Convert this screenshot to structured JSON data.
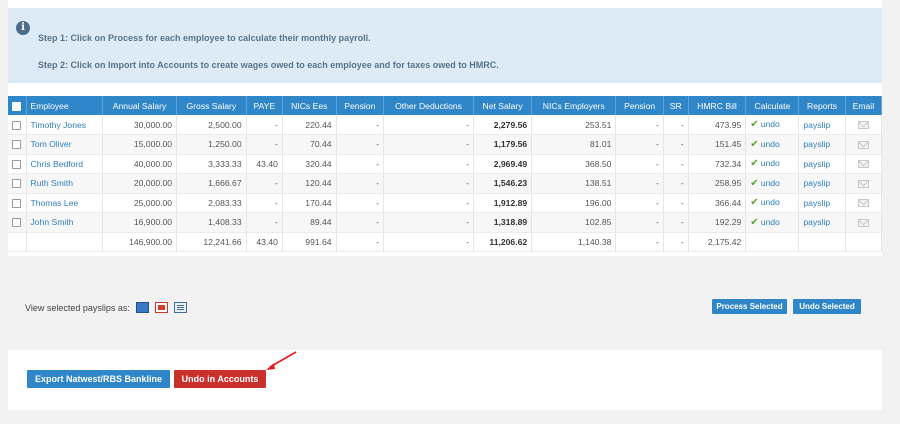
{
  "info": {
    "step1": "Step 1: Click on Process for each employee to calculate their monthly payroll.",
    "step2": "Step 2: Click on Import into Accounts to create wages owed to each employee and for taxes owed to HMRC."
  },
  "table": {
    "headers": [
      "Employee",
      "Annual Salary",
      "Gross Salary",
      "PAYE",
      "NICs Ees",
      "Pension",
      "Other Deductions",
      "Net Salary",
      "NICs Employers",
      "Pension",
      "SR",
      "HMRC Bill",
      "Calculate",
      "Reports",
      "Email"
    ],
    "rows": [
      {
        "name": "Timothy Jones",
        "annual": "30,000.00",
        "gross": "2,500.00",
        "paye": "-",
        "nics_ees": "220.44",
        "pension": "-",
        "other": "-",
        "net": "2,279.56",
        "nics_er": "253.51",
        "pension2": "-",
        "sr": "-",
        "hmrc": "473.95",
        "calculate": "undo",
        "reports": "payslip"
      },
      {
        "name": "Tom Oliver",
        "annual": "15,000.00",
        "gross": "1,250.00",
        "paye": "-",
        "nics_ees": "70.44",
        "pension": "-",
        "other": "-",
        "net": "1,179.56",
        "nics_er": "81.01",
        "pension2": "-",
        "sr": "-",
        "hmrc": "151.45",
        "calculate": "undo",
        "reports": "payslip"
      },
      {
        "name": "Chris Bedford",
        "annual": "40,000.00",
        "gross": "3,333.33",
        "paye": "43.40",
        "nics_ees": "320.44",
        "pension": "-",
        "other": "-",
        "net": "2,969.49",
        "nics_er": "368.50",
        "pension2": "-",
        "sr": "-",
        "hmrc": "732.34",
        "calculate": "undo",
        "reports": "payslip"
      },
      {
        "name": "Ruth Smith",
        "annual": "20,000.00",
        "gross": "1,666.67",
        "paye": "-",
        "nics_ees": "120.44",
        "pension": "-",
        "other": "-",
        "net": "1,546.23",
        "nics_er": "138.51",
        "pension2": "-",
        "sr": "-",
        "hmrc": "258.95",
        "calculate": "undo",
        "reports": "payslip"
      },
      {
        "name": "Thomas Lee",
        "annual": "25,000.00",
        "gross": "2,083.33",
        "paye": "-",
        "nics_ees": "170.44",
        "pension": "-",
        "other": "-",
        "net": "1,912.89",
        "nics_er": "196.00",
        "pension2": "-",
        "sr": "-",
        "hmrc": "366.44",
        "calculate": "undo",
        "reports": "payslip"
      },
      {
        "name": "John Smith",
        "annual": "16,900.00",
        "gross": "1,408.33",
        "paye": "-",
        "nics_ees": "89.44",
        "pension": "-",
        "other": "-",
        "net": "1,318.89",
        "nics_er": "102.85",
        "pension2": "-",
        "sr": "-",
        "hmrc": "192.29",
        "calculate": "undo",
        "reports": "payslip"
      }
    ],
    "totals": {
      "annual": "146,900.00",
      "gross": "12,241.66",
      "paye": "43.40",
      "nics_ees": "991.64",
      "pension": "-",
      "other": "-",
      "net": "11,206.62",
      "nics_er": "1,140.38",
      "pension2": "-",
      "sr": "-",
      "hmrc": "2,175.42"
    }
  },
  "view_label": "View selected payslips as:",
  "buttons": {
    "process_selected": "Process Selected",
    "undo_selected": "Undo Selected",
    "export": "Export Natwest/RBS Bankline",
    "undo_accounts": "Undo in Accounts"
  },
  "colors": {
    "accent": "#2f86c8",
    "danger": "#c9302c",
    "success": "#59a62b"
  }
}
